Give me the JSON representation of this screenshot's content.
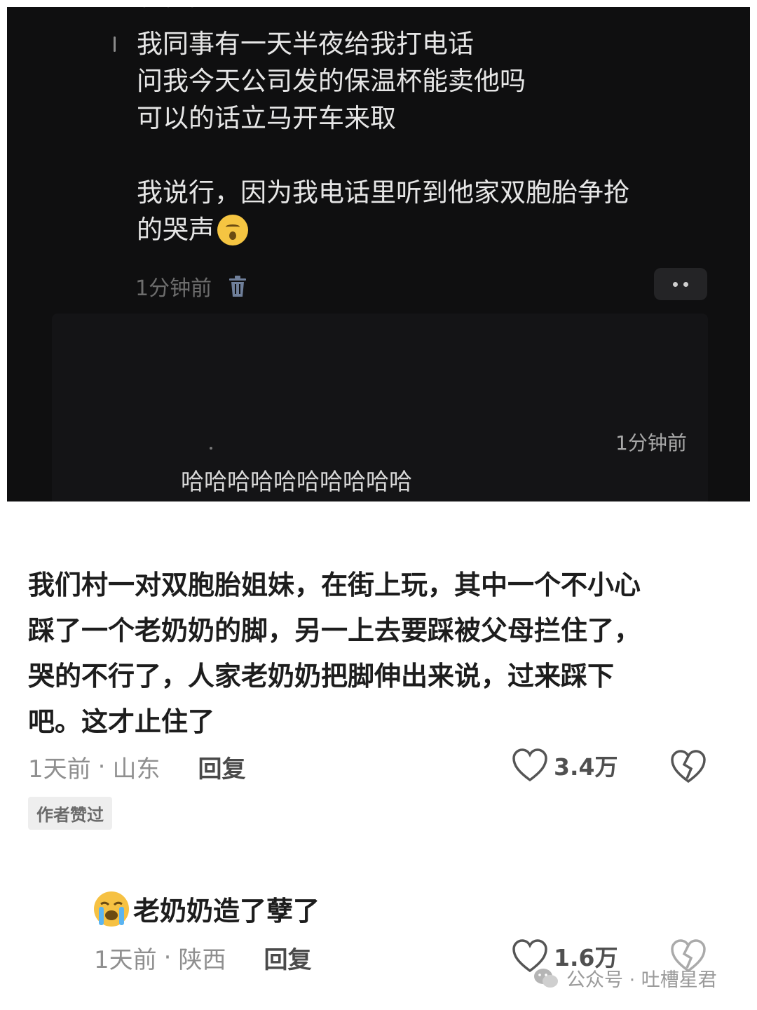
{
  "dark_panel": {
    "top_fragment": "• • •",
    "comment_lines": [
      "我同事有一天半夜给我打电话",
      "问我今天公司发的保温杯能卖他吗",
      "可以的话立马开车来取",
      "",
      "我说行，因为我电话里听到他家双胞胎争抢",
      "的哭声"
    ],
    "emoji": "sleepy-face-emoji",
    "time": "1分钟前",
    "nested_reply": {
      "time": "1分钟前",
      "text": "哈哈哈哈哈哈哈哈哈哈"
    }
  },
  "main_comment": {
    "lines": [
      "我们村一对双胞胎姐妹，在街上玩，其中一个不小心",
      "踩了一个老奶奶的脚，另一上去要踩被父母拦住了，",
      "哭的不行了，人家老奶奶把脚伸出来说，过来踩下",
      "吧。这才止住了"
    ],
    "time": "1天前",
    "separator": "·",
    "location": "山东",
    "reply_label": "回复",
    "likes": "3.4万",
    "badge": "作者赞过"
  },
  "reply_comment": {
    "emoji": "crying-face-emoji",
    "text": "老奶奶造了孽了",
    "time": "1天前",
    "separator": "·",
    "location": "陕西",
    "reply_label": "回复",
    "likes": "1.6万"
  },
  "watermark": {
    "text": "公众号 · 吐槽星君"
  },
  "colors": {
    "dark_background": "#0f0f10",
    "dark_text": "#e6e6e6",
    "muted_text": "#8f8f8f",
    "badge_background": "#eeeeee"
  }
}
